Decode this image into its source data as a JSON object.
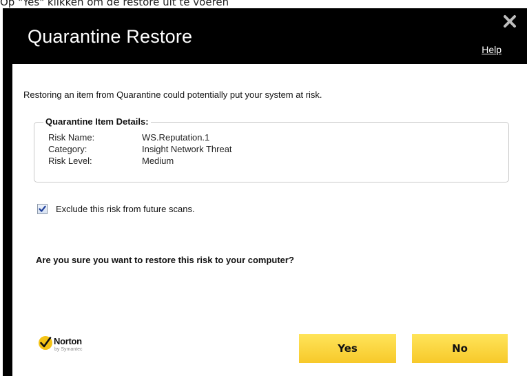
{
  "page_caption": "Op \"Yes\" klikken om de restore uit te voeren",
  "dialog": {
    "title": "Quarantine Restore",
    "help_label": "Help",
    "close_icon": "close-icon"
  },
  "content": {
    "intro": "Restoring an item from Quarantine could potentially put your system at risk.",
    "details_legend": "Quarantine Item Details:",
    "details": [
      {
        "label": "Risk Name:",
        "value": "WS.Reputation.1"
      },
      {
        "label": "Category:",
        "value": "Insight Network Threat"
      },
      {
        "label": "Risk Level:",
        "value": "Medium"
      }
    ],
    "exclude_label": "Exclude this risk from future scans.",
    "exclude_checked": true,
    "question": "Are you sure you want to restore this risk to your computer?"
  },
  "footer": {
    "logo_name": "Norton",
    "logo_sub": "by Symantec",
    "yes_label": "Yes",
    "no_label": "No"
  },
  "colors": {
    "titlebar": "#000000",
    "button": "#f9d13a",
    "checkmark": "#1f3f9a",
    "logo_check_bg": "#f4c316"
  }
}
